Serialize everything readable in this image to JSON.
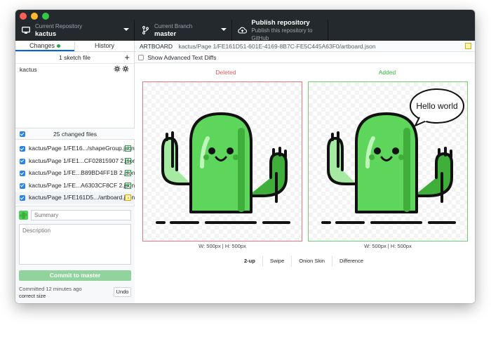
{
  "toolbar": {
    "repo": {
      "label": "Current Repository",
      "value": "kactus"
    },
    "branch": {
      "label": "Current Branch",
      "value": "master"
    },
    "publish": {
      "label": "Publish repository",
      "sub": "Publish this repository to GitHub"
    }
  },
  "sidebar": {
    "tabs": [
      {
        "label": "Changes"
      },
      {
        "label": "History"
      }
    ],
    "sketch_header": "1 sketch file",
    "sketch_files": [
      {
        "name": "kactus"
      }
    ],
    "changed_header": "25 changed files",
    "files": [
      {
        "name": "kactus/Page 1/FE16.../shapeGroup.json",
        "status": "added"
      },
      {
        "name": "kactus/Page 1/FE1...CF02815907 2.json",
        "status": "added"
      },
      {
        "name": "kactus/Page 1/FE...B89BD4FF1B 2.json",
        "status": "added"
      },
      {
        "name": "kactus/Page 1/FE...A6303CF8CF 2.json",
        "status": "added"
      },
      {
        "name": "kactus/Page 1/FE161D5.../artboard.json",
        "status": "modified"
      }
    ],
    "commit": {
      "summary_placeholder": "Summary",
      "description_placeholder": "Description",
      "button": "Commit to master",
      "last_commit_time": "Committed 12 minutes ago",
      "last_commit_msg": "correct size",
      "undo": "Undo"
    }
  },
  "main": {
    "path_label": "ARTBOARD",
    "path": "kactus/Page 1/FE161D51-601E-4169-8B7C-FE5C445A63F0/artboard.json",
    "advanced_toggle": "Show Advanced Text Diffs",
    "deleted_label": "Deleted",
    "added_label": "Added",
    "dims_left": "W: 500px | H: 500px",
    "dims_right": "W: 500px | H: 500px",
    "speech_text": "Hello world",
    "modes": [
      {
        "label": "2-up"
      },
      {
        "label": "Swipe"
      },
      {
        "label": "Onion Skin"
      },
      {
        "label": "Difference"
      }
    ],
    "colors": {
      "deleted": "#e25d5d",
      "added": "#35b53d",
      "cactus": "#5ed65b"
    }
  }
}
